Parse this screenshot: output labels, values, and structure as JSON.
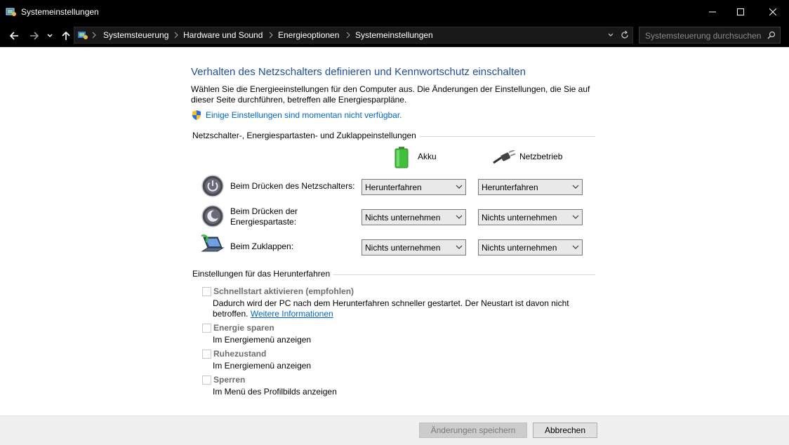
{
  "window": {
    "title": "Systemeinstellungen"
  },
  "breadcrumbs": [
    "Systemsteuerung",
    "Hardware und Sound",
    "Energieoptionen",
    "Systemeinstellungen"
  ],
  "search": {
    "placeholder": "Systemsteuerung durchsuchen"
  },
  "page": {
    "heading": "Verhalten des Netzschalters definieren und Kennwortschutz einschalten",
    "description": "Wählen Sie die Energieeinstellungen für den Computer aus. Die Änderungen der Einstellungen, die Sie auf dieser Seite durchführen, betreffen alle Energiesparpläne.",
    "unavailable_link": "Einige Einstellungen sind momentan nicht verfügbar."
  },
  "power_section": {
    "title": "Netzschalter-, Energiespartasten- und Zuklappeinstellungen",
    "col_battery": "Akku",
    "col_ac": "Netzbetrieb",
    "rows": [
      {
        "label": "Beim Drücken des Netzschalters:",
        "battery": "Herunterfahren",
        "ac": "Herunterfahren"
      },
      {
        "label": "Beim Drücken der Energiespartaste:",
        "battery": "Nichts unternehmen",
        "ac": "Nichts unternehmen"
      },
      {
        "label": "Beim Zuklappen:",
        "battery": "Nichts unternehmen",
        "ac": "Nichts unternehmen"
      }
    ]
  },
  "shutdown_section": {
    "title": "Einstellungen für das Herunterfahren",
    "options": [
      {
        "label": "Schnellstart aktivieren (empfohlen)",
        "description": "Dadurch wird der PC nach dem Herunterfahren schneller gestartet. Der Neustart ist davon nicht betroffen.",
        "link": "Weitere Informationen",
        "checked": false
      },
      {
        "label": "Energie sparen",
        "description": "Im Energiemenü anzeigen",
        "checked": false
      },
      {
        "label": "Ruhezustand",
        "description": "Im Energiemenü anzeigen",
        "checked": false
      },
      {
        "label": "Sperren",
        "description": "Im Menü des Profilbilds anzeigen",
        "checked": false
      }
    ]
  },
  "footer": {
    "save": "Änderungen speichern",
    "cancel": "Abbrechen"
  },
  "colors": {
    "heading": "#1e4e9e",
    "link": "#0066cc",
    "titlebar": "#000000"
  }
}
